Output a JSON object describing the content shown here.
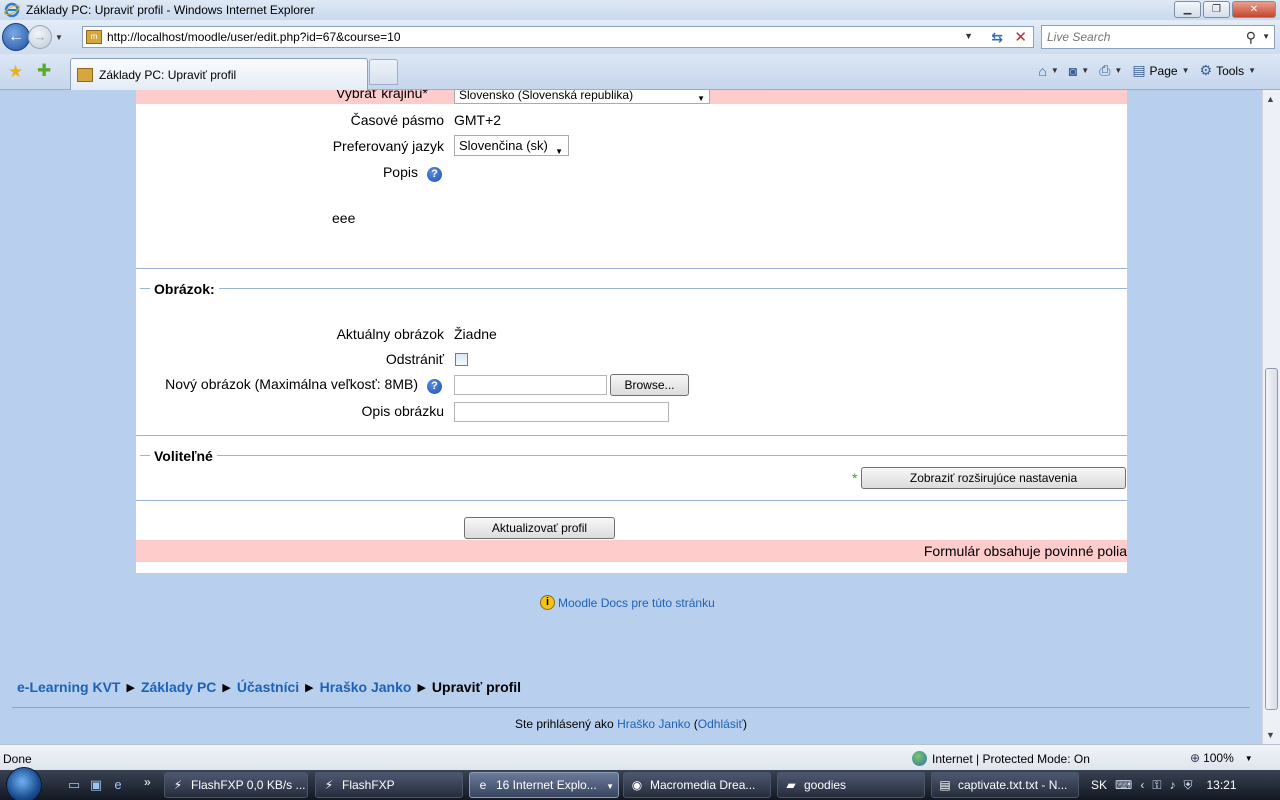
{
  "window": {
    "title": "Základy PC: Upraviť profil - Windows Internet Explorer",
    "min_glyph": "▁",
    "max_glyph": "❐",
    "close_glyph": "✕"
  },
  "browser": {
    "address": "http://localhost/moodle/user/edit.php?id=67&course=10",
    "search_placeholder": "Live Search",
    "tab_label": "Základy PC: Upraviť profil",
    "cmd_page": "Page",
    "cmd_tools": "Tools"
  },
  "form": {
    "country_label": "Vybrať krajinu*",
    "country_value": "Slovensko (Slovenská republika)",
    "timezone_label": "Časové pásmo",
    "timezone_value": "GMT+2",
    "language_label": "Preferovaný jazyk",
    "language_value": "Slovenčina (sk)",
    "description_label": "Popis",
    "description_value": "eee",
    "picture_legend": "Obrázok:",
    "current_picture_label": "Aktuálny obrázok",
    "current_picture_value": "Žiadne",
    "delete_label": "Odstrániť",
    "new_picture_label": "Nový obrázok (Maximálna veľkosť: 8MB)",
    "browse_button": "Browse...",
    "picture_desc_label": "Opis obrázku",
    "optional_legend": "Voliteľné",
    "advanced_button": "Zobraziť rozširujúce nastavenia",
    "submit_button": "Aktualizovať profil",
    "required_note": "Formulár obsahuje povinné polia"
  },
  "docs_link": "Moodle Docs pre túto stránku",
  "breadcrumb": {
    "items": [
      "e-Learning KVT",
      "Základy PC",
      "Účastníci",
      "Hraško Janko"
    ],
    "current": "Upraviť profil"
  },
  "login": {
    "prefix": "Ste prihlásený ako",
    "user": "Hraško Janko",
    "logout": "Odhlásiť"
  },
  "status": {
    "text": "Done",
    "zone": "Internet | Protected Mode: On",
    "zoom": "100%"
  },
  "taskbar": {
    "tasks": [
      "FlashFXP 0,0 KB/s ...",
      "FlashFXP",
      "16 Internet Explo...",
      "Macromedia Drea...",
      "goodies",
      "captivate.txt.txt - N..."
    ],
    "lang": "SK",
    "clock": "13:21"
  },
  "colors": {
    "page_bg": "#b8cfee",
    "required_row": "#ffcccc",
    "link": "#1f62b4"
  }
}
